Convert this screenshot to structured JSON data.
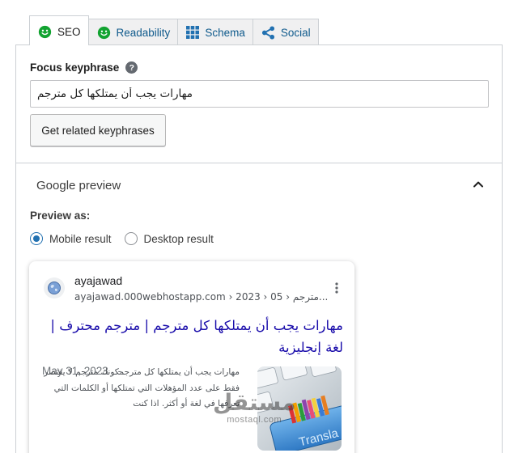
{
  "tabs": [
    {
      "label": "SEO",
      "icon": "smile-icon",
      "active": true
    },
    {
      "label": "Readability",
      "icon": "smile-icon",
      "active": false
    },
    {
      "label": "Schema",
      "icon": "grid-icon",
      "active": false
    },
    {
      "label": "Social",
      "icon": "share-icon",
      "active": false
    }
  ],
  "focus": {
    "label": "Focus keyphrase",
    "help_icon": "?",
    "value": "مهارات يجب أن يمتلكها كل مترجم",
    "related_button": "Get related keyphrases"
  },
  "google_preview": {
    "title": "Google preview",
    "preview_as": "Preview as:",
    "options": [
      "Mobile result",
      "Desktop result"
    ],
    "selected": "Mobile result"
  },
  "result": {
    "site_name": "ayajawad",
    "url": "ayajawad.000webhostapp.com › 2023 › 05 › مترجم...",
    "title": "مهارات يجب أن يمتلكها كل مترجم | مترجم محترف | لغة إنجليزية",
    "date": "May 31, 2023",
    "date_sep": "-",
    "snippet": "مهارات يجب أن يمتلكها كل مترجمكونك مترجم لا يقتصر فقط على عدد المؤهلات التي تمتلكها أو الكلمات التي تعرفها في لغة أو أكثر. اذا كنت",
    "thumbnail_word": "Transla"
  },
  "watermark": {
    "main": "مستقل",
    "sub": "mostaql.com"
  },
  "colors": {
    "link": "#1a0dab",
    "smile": "#12a331",
    "tab_link": "#0f5a8c",
    "radio": "#2271b1"
  }
}
